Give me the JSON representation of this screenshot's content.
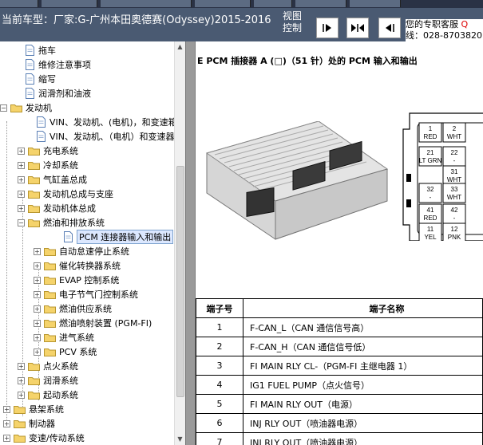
{
  "header": {
    "title": "当前车型：厂家:G-广州本田奥德赛(Odyssey)2015-2016",
    "view_label": "视图控制",
    "contact_line1": "您的专职客服",
    "contact_q": "Q",
    "contact_line2": "线：028-8703820"
  },
  "tree": {
    "items": [
      {
        "label": "拖车",
        "type": "doc"
      },
      {
        "label": "维修注意事项",
        "type": "doc"
      },
      {
        "label": "缩写",
        "type": "doc"
      },
      {
        "label": "润滑剂和油液",
        "type": "doc"
      },
      {
        "label": "发动机",
        "type": "folder"
      },
      {
        "label": "VIN、发动机、(电机)，和变速箱",
        "type": "doc"
      },
      {
        "label": "VIN、发动机、（电机）和变速器",
        "type": "doc"
      },
      {
        "label": "充电系统",
        "type": "folder"
      },
      {
        "label": "冷却系统",
        "type": "folder"
      },
      {
        "label": "气缸盖总成",
        "type": "folder"
      },
      {
        "label": "发动机总成与支座",
        "type": "folder"
      },
      {
        "label": "发动机体总成",
        "type": "folder"
      },
      {
        "label": "燃油和排放系统",
        "type": "folder"
      },
      {
        "label": "PCM 连接器输入和输出",
        "type": "doc"
      },
      {
        "label": "自动怠速停止系统",
        "type": "folder"
      },
      {
        "label": "催化转换器系统",
        "type": "folder"
      },
      {
        "label": "EVAP 控制系统",
        "type": "folder"
      },
      {
        "label": "电子节气门控制系统",
        "type": "folder"
      },
      {
        "label": "燃油供应系统",
        "type": "folder"
      },
      {
        "label": "燃油喷射装置 (PGM-FI)",
        "type": "folder"
      },
      {
        "label": "进气系统",
        "type": "folder"
      },
      {
        "label": "PCV 系统",
        "type": "folder"
      },
      {
        "label": "点火系统",
        "type": "folder"
      },
      {
        "label": "润滑系统",
        "type": "folder"
      },
      {
        "label": "起动系统",
        "type": "folder"
      },
      {
        "label": "悬架系统",
        "type": "folder"
      },
      {
        "label": "制动器",
        "type": "folder"
      },
      {
        "label": "变速/传动系统",
        "type": "folder"
      }
    ]
  },
  "content": {
    "heading": "E PCM 插接器 A (□)（51 针）处的 PCM 输入和输出",
    "connector_pins": [
      {
        "num": "1",
        "color": "RED"
      },
      {
        "num": "2",
        "color": "WHT"
      },
      {
        "num": "21",
        "color": "LT GRN"
      },
      {
        "num": "22",
        "color": "-"
      },
      {
        "num": "31",
        "color": "WHT"
      },
      {
        "num": "32",
        "color": "-"
      },
      {
        "num": "33",
        "color": "WHT"
      },
      {
        "num": "41",
        "color": "RED"
      },
      {
        "num": "42",
        "color": "-"
      },
      {
        "num": "11",
        "color": "YEL"
      },
      {
        "num": "12",
        "color": "PNK"
      }
    ],
    "table": {
      "headers": [
        "端子号",
        "端子名称"
      ],
      "rows": [
        {
          "num": "1",
          "name": "F-CAN_L（CAN 通信信号高）"
        },
        {
          "num": "2",
          "name": "F-CAN_H（CAN 通信信号低）"
        },
        {
          "num": "3",
          "name": "FI MAIN RLY CL-（PGM-FI 主继电器 1）"
        },
        {
          "num": "4",
          "name": "IG1 FUEL PUMP（点火信号）"
        },
        {
          "num": "5",
          "name": "FI MAIN RLY OUT（电源）"
        },
        {
          "num": "6",
          "name": "INJ RLY OUT（喷油器电源）"
        },
        {
          "num": "7",
          "name": "INJ RLY OUT（喷油器电源）"
        }
      ]
    }
  }
}
